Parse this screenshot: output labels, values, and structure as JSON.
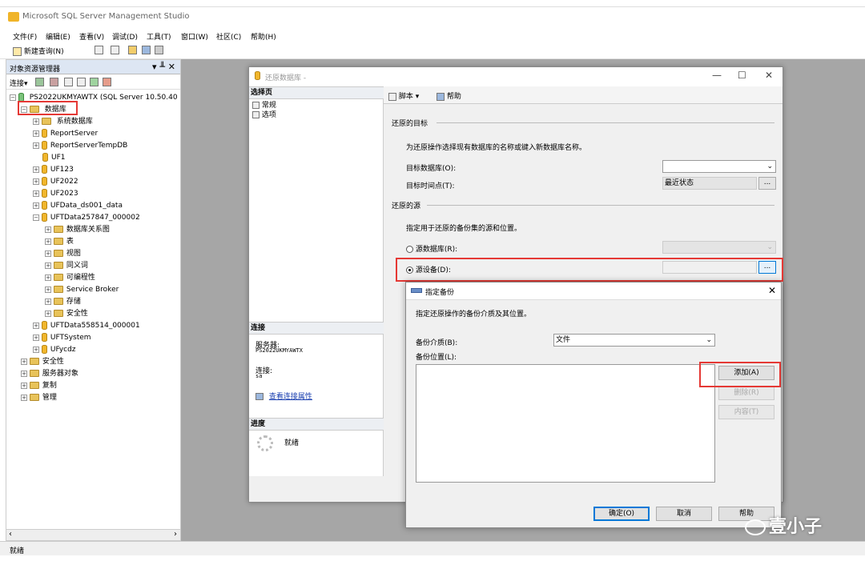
{
  "app": {
    "title": "Microsoft SQL Server Management Studio"
  },
  "menu": [
    "文件(F)",
    "编辑(E)",
    "查看(V)",
    "调试(D)",
    "工具(T)",
    "窗口(W)",
    "社区(C)",
    "帮助(H)"
  ],
  "toolbar": {
    "new_query": "新建查询(N)"
  },
  "object_explorer": {
    "title": "对象资源管理器",
    "connect": "连接▾",
    "pin": "▾ ╨ ✕",
    "server": "PS2022UKMYAWTX (SQL Server 10.50.40",
    "databases": "数据库",
    "system_databases": "系统数据库",
    "db_items": [
      "ReportServer",
      "ReportServerTempDB",
      "UF1",
      "UF123",
      "UF2022",
      "UF2023",
      "UFData_ds001_data",
      "UFTData257847_000002"
    ],
    "db_children": [
      "数据库关系图",
      "表",
      "视图",
      "同义词",
      "可编程性",
      "Service Broker",
      "存储",
      "安全性"
    ],
    "db_items_after": [
      "UFTData558514_000001",
      "UFTSystem",
      "UFycdz"
    ],
    "root_items": [
      "安全性",
      "服务器对象",
      "复制",
      "管理"
    ]
  },
  "status": "就绪",
  "restore_dialog": {
    "title": "还原数据库 -",
    "select_page": "选择页",
    "pages": [
      "常规",
      "选项"
    ],
    "connection_head": "连接",
    "server_label": "服务器:",
    "server_value": "PS2022UKMYAWTX",
    "connection_label": "连接:",
    "connection_value": "sa",
    "view_props": "查看连接属性",
    "progress_head": "进度",
    "progress_status": "就绪",
    "script": "脚本",
    "help": "帮助",
    "target_group": "还原的目标",
    "target_desc": "为还原操作选择现有数据库的名称或键入新数据库名称。",
    "target_db_label": "目标数据库(O):",
    "target_time_label": "目标时间点(T):",
    "target_time_value": "最近状态",
    "source_group": "还原的源",
    "source_desc": "指定用于还原的备份集的源和位置。",
    "source_db_label": "源数据库(R):",
    "source_device_label": "源设备(D):",
    "dots": "..."
  },
  "specify_backup": {
    "title": "指定备份",
    "desc": "指定还原操作的备份介质及其位置。",
    "media_label": "备份介质(B):",
    "media_value": "文件",
    "location_label": "备份位置(L):",
    "add": "添加(A)",
    "remove": "删除(R)",
    "contents": "内容(T)",
    "ok": "确定(O)",
    "cancel": "取消",
    "help": "帮助"
  },
  "watermark": "壹小子",
  "colors": {
    "highlight": "#e53935",
    "accent": "#0078d7"
  }
}
